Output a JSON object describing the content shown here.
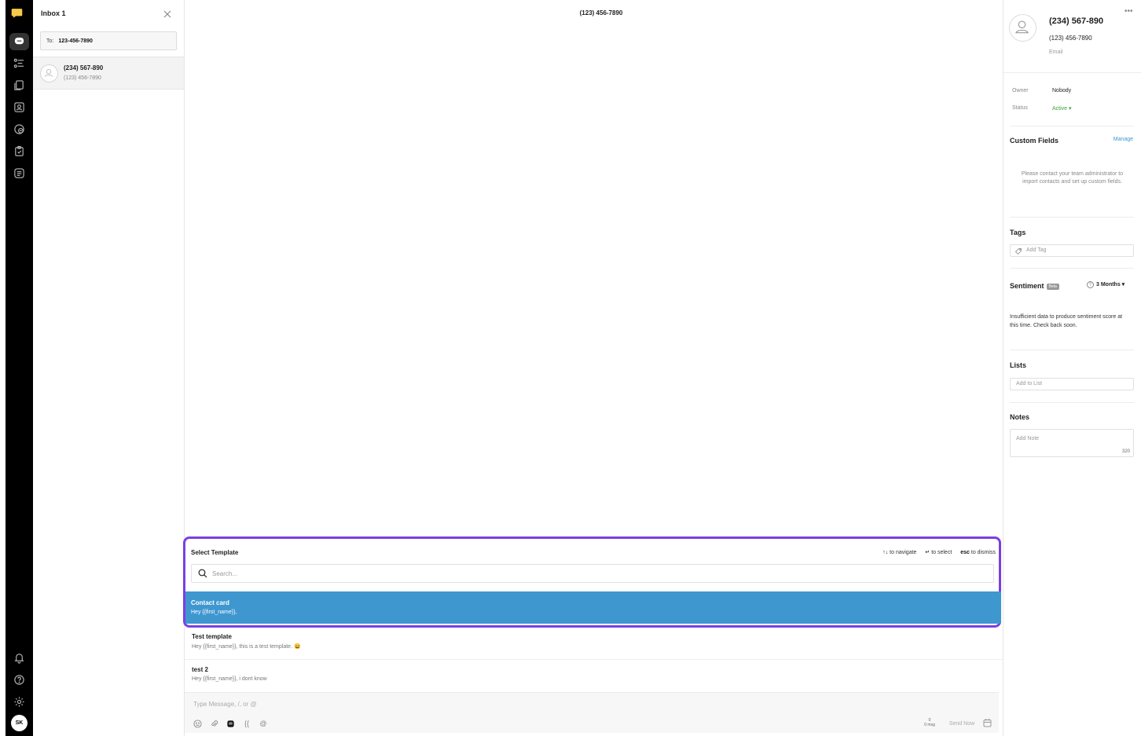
{
  "sidebar": {
    "user_initials": "SK"
  },
  "conversation_list": {
    "inbox_title": "Inbox 1",
    "to_label": "To:",
    "to_value": "123-456-7890",
    "items": [
      {
        "name": "(234) 567-890",
        "subtitle": "(123) 456-7890"
      }
    ]
  },
  "main": {
    "title": "(123) 456-7890",
    "template_picker": {
      "heading": "Select Template",
      "hint_navigate_key": "↑↓",
      "hint_navigate": "to navigate",
      "hint_select_key": "↵",
      "hint_select": "to select",
      "hint_dismiss_key": "esc",
      "hint_dismiss": "to dismiss",
      "search_placeholder": "Search...",
      "templates": [
        {
          "name": "Contact card",
          "preview": "Hey {{first_name}},"
        },
        {
          "name": "Test template",
          "preview": "Hey {{first_name}}, this is a test template. 😀"
        },
        {
          "name": "test 2",
          "preview": "Hey {{first_name}}, i dont know"
        }
      ]
    },
    "composer": {
      "placeholder": "Type Message, /, or @",
      "brace_label": "{{",
      "at_label": "@",
      "msg_count": "0",
      "msg_unit": "0 msg",
      "send_label": "Send Now"
    }
  },
  "contact": {
    "more": "•••",
    "name": "(234) 567-890",
    "phone": "(123) 456-7890",
    "email_label": "Email",
    "owner_label": "Owner",
    "owner_value": "Nobody",
    "status_label": "Status",
    "status_value": "Active ▾",
    "custom_fields_title": "Custom Fields",
    "manage_label": "Manage",
    "custom_fields_info": "Please contact your team administrator to import contacts and set up custom fields.",
    "tags_title": "Tags",
    "tags_placeholder": "Add Tag",
    "sentiment_title": "Sentiment",
    "sentiment_badge": "Beta",
    "sentiment_period": "3 Months ▾",
    "sentiment_text": "Insufficient data to produce sentiment score at this time. Check back soon.",
    "lists_title": "Lists",
    "lists_placeholder": "Add to List",
    "notes_title": "Notes",
    "notes_placeholder": "Add Note",
    "notes_counter": "320"
  },
  "colors": {
    "accent": "#7b3fe4",
    "highlight": "#3f97d0",
    "status_active": "#3aa53a",
    "rail": "#000000"
  }
}
